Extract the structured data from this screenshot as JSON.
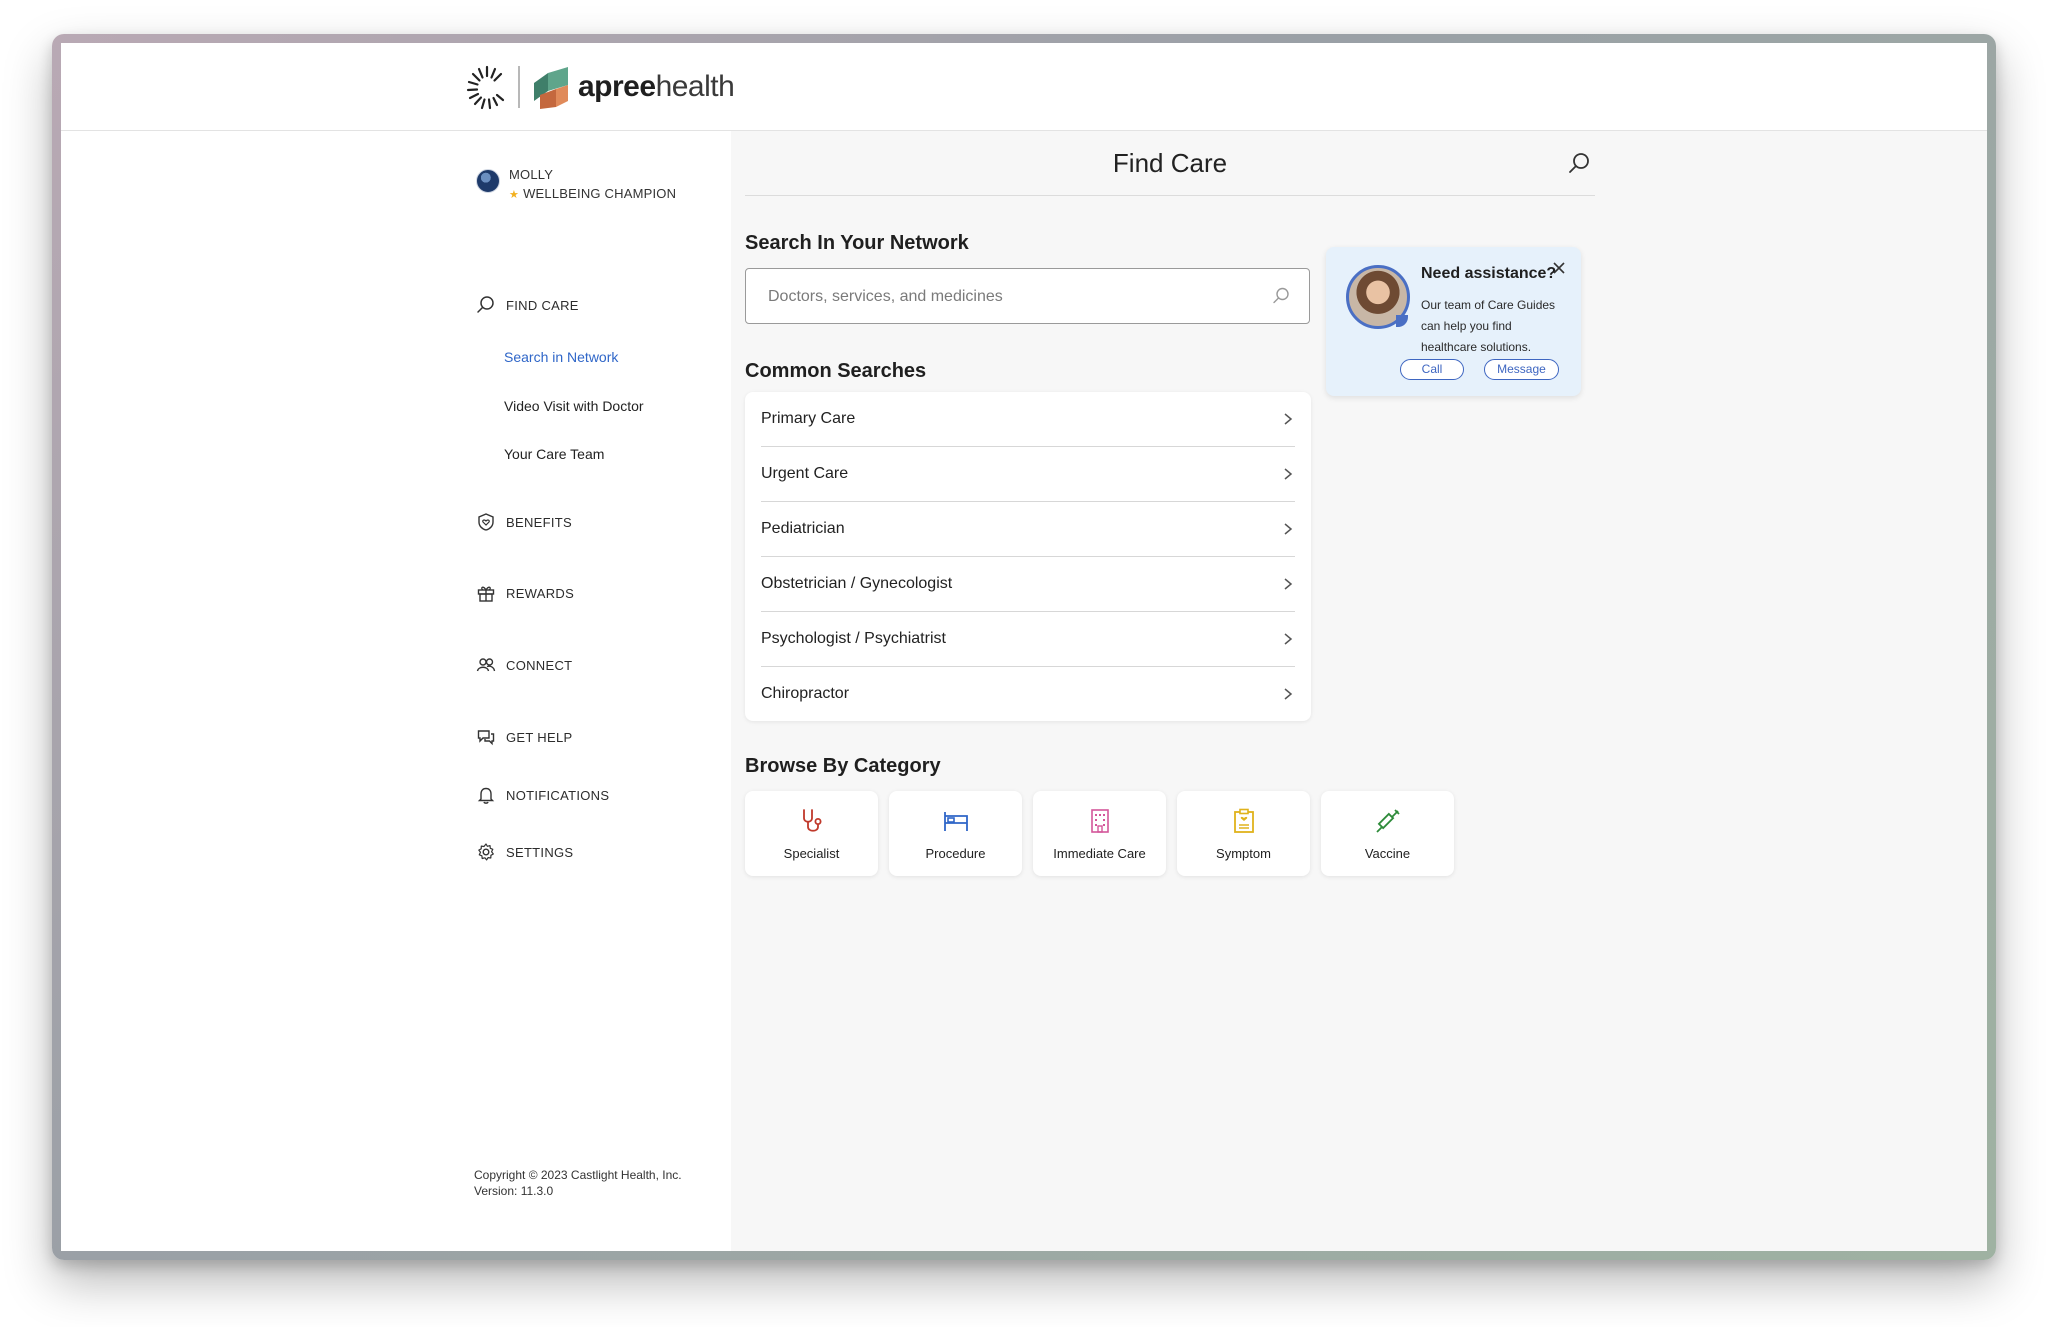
{
  "brand": {
    "name_bold": "apree",
    "name_light": "health"
  },
  "profile": {
    "name": "MOLLY",
    "role": "WELLBEING CHAMPION"
  },
  "nav": {
    "find_care": "FIND CARE",
    "sub": [
      "Search in Network",
      "Video Visit with Doctor",
      "Your Care Team"
    ],
    "benefits": "BENEFITS",
    "rewards": "REWARDS",
    "connect": "CONNECT",
    "get_help": "GET HELP",
    "notifications": "NOTIFICATIONS",
    "settings": "SETTINGS"
  },
  "footer": {
    "copyright": "Copyright © 2023 Castlight Health, Inc.",
    "version": "Version: 11.3.0"
  },
  "main": {
    "title": "Find Care",
    "search_heading": "Search In Your Network",
    "search_placeholder": "Doctors, services, and medicines",
    "common_heading": "Common Searches",
    "common": [
      "Primary Care",
      "Urgent Care",
      "Pediatrician",
      "Obstetrician / Gynecologist",
      "Psychologist / Psychiatrist",
      "Chiropractor"
    ],
    "browse_heading": "Browse By Category",
    "categories": [
      {
        "label": "Specialist",
        "icon": "stethoscope-icon",
        "color": "#c0392b"
      },
      {
        "label": "Procedure",
        "icon": "hospital-bed-icon",
        "color": "#2f66c8"
      },
      {
        "label": "Immediate Care",
        "icon": "building-icon",
        "color": "#d4569a"
      },
      {
        "label": "Symptom",
        "icon": "clipboard-icon",
        "color": "#e0b21c"
      },
      {
        "label": "Vaccine",
        "icon": "syringe-icon",
        "color": "#2e8b3a"
      }
    ]
  },
  "assist": {
    "title": "Need assistance?",
    "body": "Our team of Care Guides can help you find healthcare solutions.",
    "call": "Call",
    "message": "Message"
  },
  "colors": {
    "accent_blue": "#2f66c8",
    "panel_bg": "#f7f7f7",
    "assist_bg": "#e6f1fb"
  }
}
